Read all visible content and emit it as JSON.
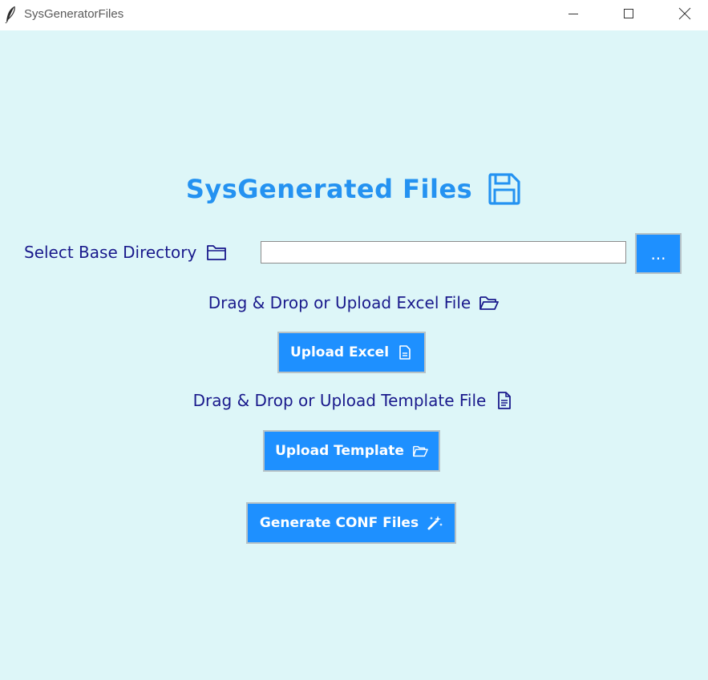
{
  "window": {
    "title": "SysGeneratorFiles",
    "app_icon": "feather-icon",
    "controls": [
      "minimize-icon",
      "maximize-icon",
      "close-icon"
    ]
  },
  "main": {
    "heading": "SysGenerated Files",
    "heading_icon": "floppy-disk-icon",
    "base_directory": {
      "label": "Select Base Directory",
      "icon": "folder-icon",
      "input_value": "",
      "browse_label": "..."
    },
    "excel": {
      "label": "Drag & Drop or Upload Excel File",
      "label_icon": "open-folder-icon",
      "button_label": "Upload Excel",
      "button_icon": "document-icon"
    },
    "template": {
      "label": "Drag & Drop or Upload Template File",
      "label_icon": "document-lines-icon",
      "button_label": "Upload Template",
      "button_icon": "open-folder-icon"
    },
    "generate": {
      "button_label": "Generate CONF Files",
      "button_icon": "magic-wand-icon"
    }
  },
  "colors": {
    "background": "#ddf6f8",
    "heading": "#2492f1",
    "label": "#1a1a8c",
    "button": "#1e90ff",
    "button_text": "#ffffff"
  }
}
